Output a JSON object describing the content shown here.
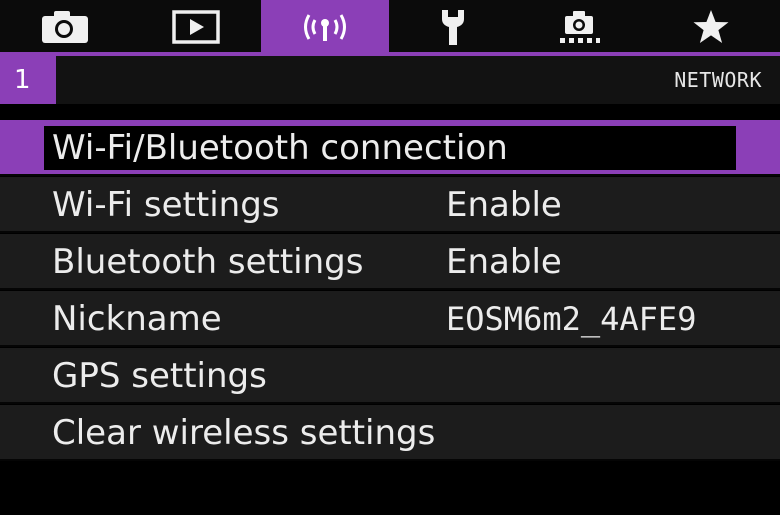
{
  "tabs": [
    {
      "icon": "camera-icon",
      "active": false
    },
    {
      "icon": "playback-icon",
      "active": false
    },
    {
      "icon": "wireless-icon",
      "active": true
    },
    {
      "icon": "wrench-icon",
      "active": false
    },
    {
      "icon": "custom-camera-icon",
      "active": false
    },
    {
      "icon": "star-icon",
      "active": false
    }
  ],
  "subheader": {
    "page_number": "1",
    "title": "NETWORK"
  },
  "menu": {
    "items": [
      {
        "label": "Wi-Fi/Bluetooth connection",
        "value": "",
        "selected": true
      },
      {
        "label": "Wi-Fi settings",
        "value": "Enable",
        "selected": false
      },
      {
        "label": "Bluetooth settings",
        "value": "Enable",
        "selected": false
      },
      {
        "label": "Nickname",
        "value": "EOSM6m2_4AFE9",
        "selected": false
      },
      {
        "label": "GPS settings",
        "value": "",
        "selected": false
      },
      {
        "label": "Clear wireless settings",
        "value": "",
        "selected": false
      }
    ]
  },
  "colors": {
    "accent": "#8b3fb7",
    "background": "#000000",
    "row": "#1c1c1c",
    "text": "#ececec"
  }
}
